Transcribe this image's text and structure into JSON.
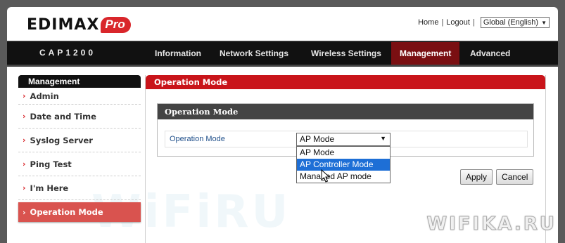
{
  "header": {
    "brand": "EDIMAX",
    "brand_tag": "Pro",
    "links": {
      "home": "Home",
      "logout": "Logout",
      "sep": "|"
    },
    "language": "Global (English)"
  },
  "nav": {
    "model": "CAP1200",
    "items": [
      "Information",
      "Network Settings",
      "Wireless Settings",
      "Management",
      "Advanced"
    ],
    "active": "Management"
  },
  "sidebar": {
    "title": "Management",
    "items": [
      {
        "label": "Admin"
      },
      {
        "label": "Date and Time"
      },
      {
        "label": "Syslog Server"
      },
      {
        "label": "Ping Test"
      },
      {
        "label": "I'm Here"
      },
      {
        "label": "Operation Mode"
      }
    ],
    "active": "Operation Mode"
  },
  "panel": {
    "title": "Operation Mode",
    "section_title": "Operation Mode",
    "field_label": "Operation Mode",
    "select_value": "AP Mode",
    "options": [
      "AP Mode",
      "AP Controller Mode",
      "Managed AP mode"
    ],
    "highlighted_option": "AP Controller Mode"
  },
  "buttons": {
    "apply": "Apply",
    "cancel": "Cancel"
  },
  "watermark": {
    "text": "WIFIKA.RU"
  },
  "colors": {
    "brand_red": "#c9141a",
    "active_tab": "#7a0f12",
    "highlight_blue": "#1e6fd6"
  }
}
